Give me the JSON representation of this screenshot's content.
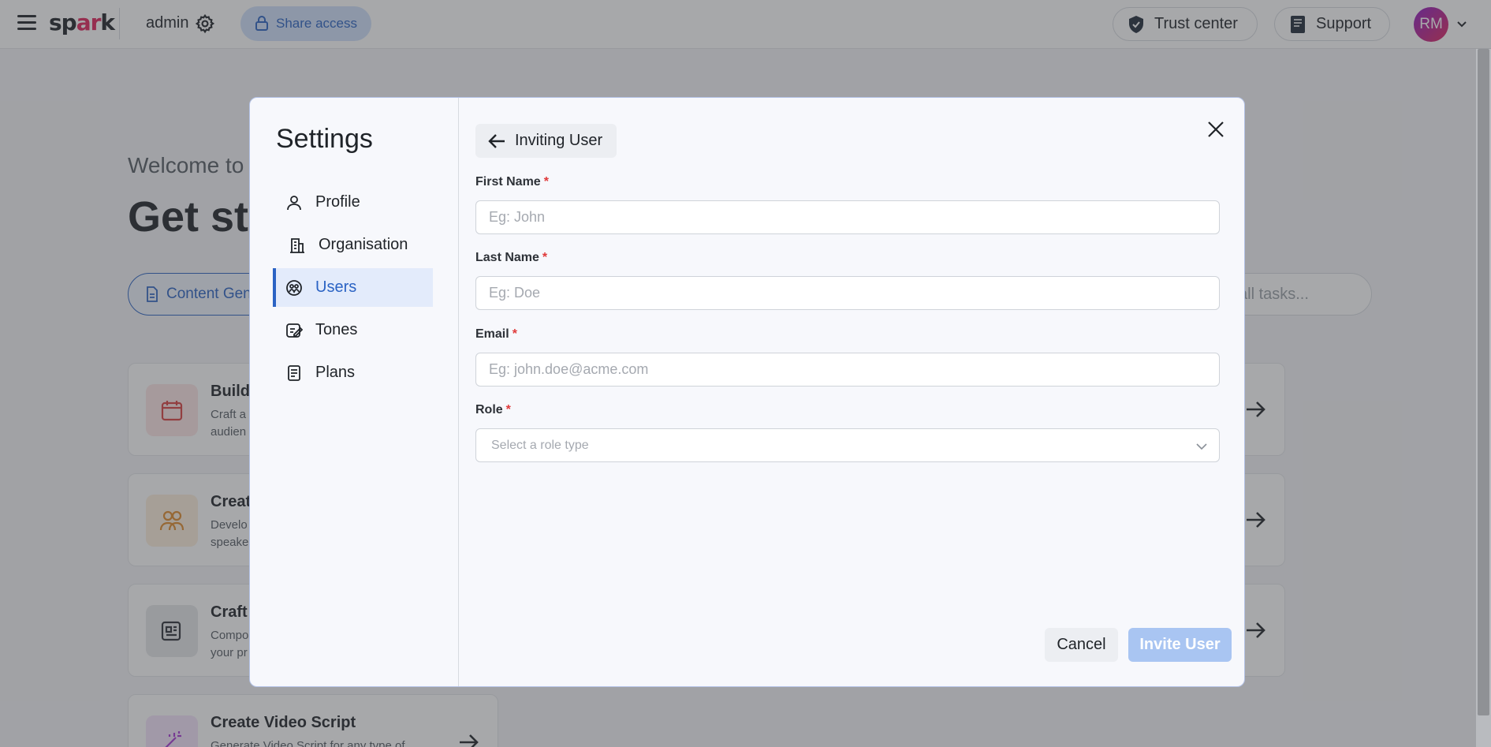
{
  "app": {
    "logo_text_a": "sp",
    "logo_text_b": "ar",
    "logo_text_c": "k",
    "user_label": "admin",
    "share_access_label": "Share access",
    "trust_center_label": "Trust center",
    "support_label": "Support",
    "avatar_initials": "RM"
  },
  "background": {
    "welcome_text": "Welcome to",
    "heading_text": "Get sta",
    "tab_label": "Content Gen",
    "search_placeholder": "all tasks...",
    "cards": [
      {
        "title": "Build",
        "desc_1": "Craft a",
        "desc_2": "audien"
      },
      {
        "title": "Creat",
        "desc_1": "Develo",
        "desc_2": "speake"
      },
      {
        "title": "Craft",
        "desc_1": "Compo",
        "desc_2": "your pr"
      },
      {
        "title": "Create Video Script",
        "desc_1": "Generate Video Script for any type of",
        "desc_2": ""
      }
    ]
  },
  "settings": {
    "title": "Settings",
    "nav": [
      {
        "label": "Profile",
        "icon": "person-icon"
      },
      {
        "label": "Organisation",
        "icon": "building-icon"
      },
      {
        "label": "Users",
        "icon": "users-icon",
        "active": true
      },
      {
        "label": "Tones",
        "icon": "tones-icon"
      },
      {
        "label": "Plans",
        "icon": "document-icon"
      }
    ]
  },
  "invite_form": {
    "back_label": "Inviting User",
    "first_name": {
      "label": "First Name",
      "required_mark": "*",
      "placeholder": "Eg: John",
      "value": ""
    },
    "last_name": {
      "label": "Last Name",
      "required_mark": "*",
      "placeholder": "Eg: Doe",
      "value": ""
    },
    "email": {
      "label": "Email",
      "required_mark": "*",
      "placeholder": "Eg: john.doe@acme.com",
      "value": ""
    },
    "role": {
      "label": "Role",
      "required_mark": "*",
      "placeholder": "Select a role type"
    },
    "cancel_label": "Cancel",
    "invite_label": "Invite User"
  },
  "colors": {
    "accent": "#2b63c4",
    "required": "#e03a3a",
    "invite_button_disabled": "#a9c5f2"
  }
}
